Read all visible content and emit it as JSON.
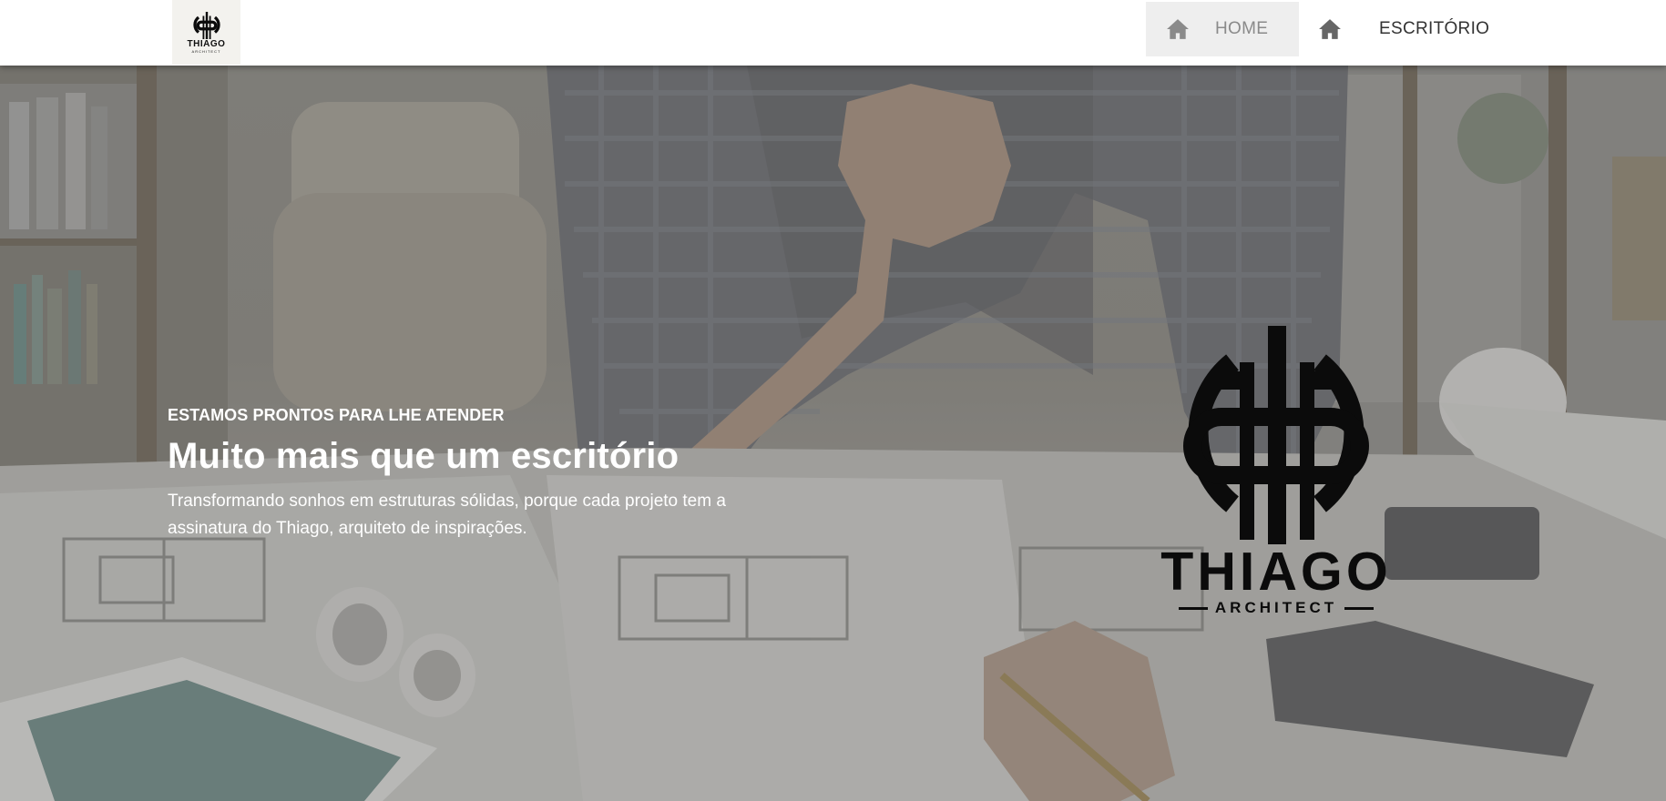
{
  "brand": {
    "name": "THIAGO",
    "tagline": "ARCHITECT"
  },
  "nav": {
    "items": [
      {
        "label": "HOME",
        "icon": "home-icon",
        "active": true
      },
      {
        "label": "ESCRITÓRIO",
        "icon": "home-icon",
        "active": false
      }
    ]
  },
  "hero": {
    "kicker": "ESTAMOS PRONTOS PARA LHE ATENDER",
    "title": "Muito mais que um escritório",
    "description": "Transformando sonhos em estruturas sólidas, porque cada projeto tem a assinatura do Thiago, arquiteto de inspirações."
  },
  "colors": {
    "navbar_bg": "#ffffff",
    "active_tab_bg": "#eeeeee",
    "hero_text": "#ffffff",
    "logo_black": "#0b0b0b"
  }
}
